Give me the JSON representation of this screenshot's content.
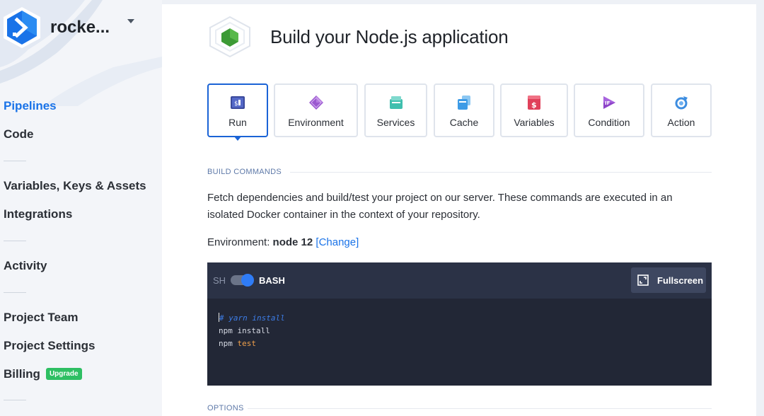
{
  "sidebar": {
    "brand_name": "rocke...",
    "items": [
      {
        "label": "Pipelines",
        "active": true
      },
      {
        "label": "Code"
      },
      {
        "label": "Variables, Keys & Assets"
      },
      {
        "label": "Integrations"
      },
      {
        "label": "Activity"
      },
      {
        "label": "Project Team"
      },
      {
        "label": "Project Settings"
      },
      {
        "label": "Billing",
        "badge": "Upgrade"
      }
    ]
  },
  "header": {
    "title": "Build your Node.js application",
    "icon": "nodejs-hexagon-icon"
  },
  "tabs": [
    {
      "label": "Run",
      "icon": "run-icon",
      "active": true
    },
    {
      "label": "Environment",
      "icon": "environment-icon"
    },
    {
      "label": "Services",
      "icon": "services-icon"
    },
    {
      "label": "Cache",
      "icon": "cache-icon"
    },
    {
      "label": "Variables",
      "icon": "variables-icon"
    },
    {
      "label": "Condition",
      "icon": "condition-icon"
    },
    {
      "label": "Action",
      "icon": "action-icon"
    }
  ],
  "build_commands": {
    "heading": "BUILD COMMANDS",
    "description": "Fetch dependencies and build/test your project on our server. These commands are executed in an isolated Docker container in the context of your repository.",
    "environment_label": "Environment:",
    "environment_value": "node 12",
    "change_link": "[Change]"
  },
  "editor": {
    "mode_left": "SH",
    "mode_right": "BASH",
    "fullscreen_label": "Fullscreen",
    "lines": [
      {
        "comment": "# yarn install"
      },
      {
        "text": "npm install"
      },
      {
        "text": "npm ",
        "keyword": "test"
      }
    ]
  },
  "options": {
    "heading": "OPTIONS"
  },
  "colors": {
    "accent": "#1a73e8",
    "active_tab_border": "#1a63d6",
    "editor_bg": "#222736",
    "badge_green": "#2ebf63"
  }
}
